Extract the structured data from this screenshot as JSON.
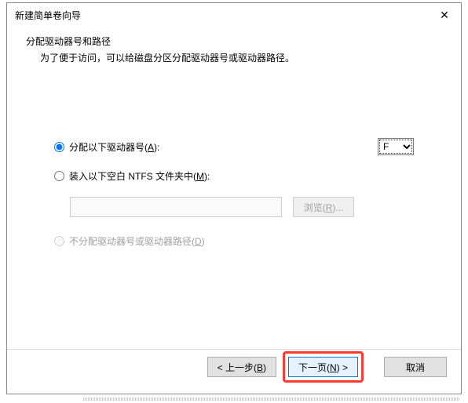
{
  "dialog": {
    "title": "新建简单卷向导",
    "close": "✕"
  },
  "header": {
    "title": "分配驱动器号和路径",
    "description": "为了便于访问，可以给磁盘分区分配驱动器号或驱动器路径。"
  },
  "options": {
    "assign_letter": {
      "label_pre": "分配以下驱动器号(",
      "label_key": "A",
      "label_post": "):",
      "selected_value": "F"
    },
    "mount_ntfs": {
      "label_pre": "装入以下空白 NTFS 文件夹中(",
      "label_key": "M",
      "label_post": "):"
    },
    "browse": {
      "label_pre": "浏览(",
      "label_key": "R",
      "label_post": ")..."
    },
    "no_assign": {
      "label_pre": "不分配驱动器号或驱动器路径(",
      "label_key": "D",
      "label_post": ")"
    }
  },
  "buttons": {
    "back": {
      "pre": "< 上一步(",
      "key": "B",
      "post": ")"
    },
    "next": {
      "pre": "下一页(",
      "key": "N",
      "post": ") >"
    },
    "cancel": "取消"
  }
}
